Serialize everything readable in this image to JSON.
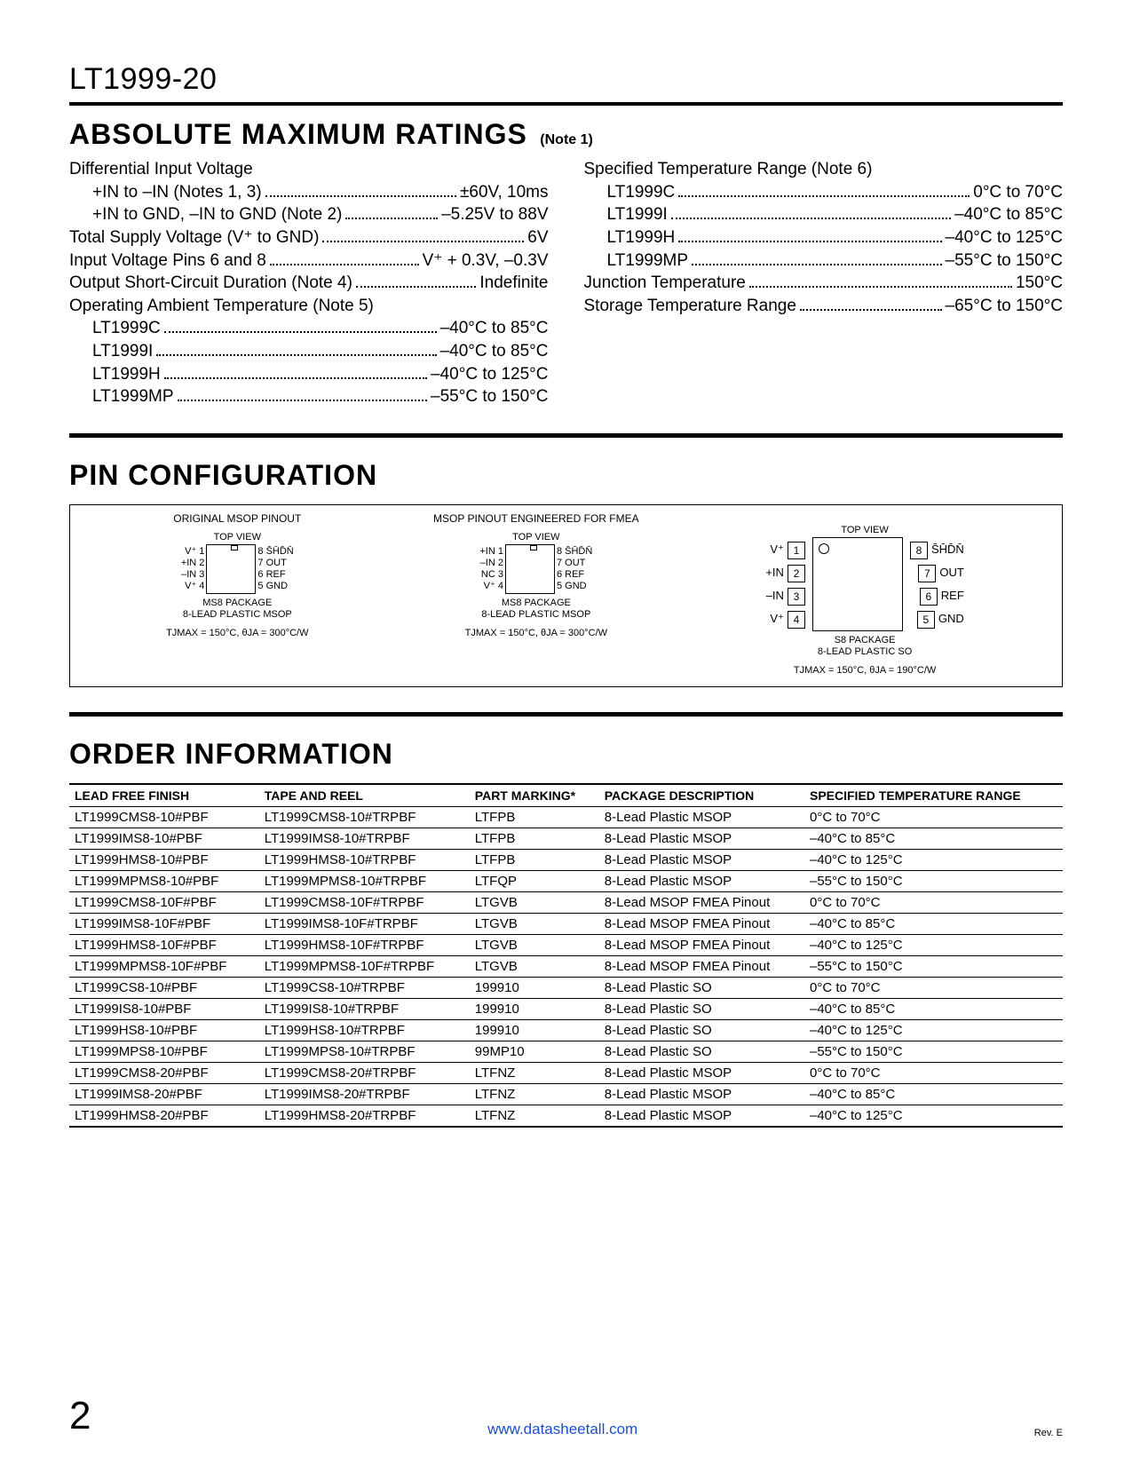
{
  "header": {
    "part": "LT1999-20"
  },
  "sections": {
    "abs": {
      "title": "ABSOLUTE MAXIMUM RATINGS",
      "note": "(Note 1)"
    },
    "pin": {
      "title": "PIN CONFIGURATION"
    },
    "order": {
      "title": "ORDER INFORMATION"
    }
  },
  "abs_left": {
    "h0": "Differential Input Voltage",
    "l1a": "+IN to –IN (Notes 1, 3)",
    "l1b": "±60V, 10ms",
    "l2a": "+IN to GND, –IN to GND (Note 2)",
    "l2b": "–5.25V to 88V",
    "l3a": "Total Supply Voltage (V⁺ to GND)",
    "l3b": "6V",
    "l4a": "Input Voltage Pins 6 and 8",
    "l4b": "V⁺ + 0.3V, –0.3V",
    "l5a": "Output Short-Circuit Duration (Note 4)",
    "l5b": "Indefinite",
    "l6a": "Operating Ambient Temperature (Note 5)",
    "i1a": "LT1999C",
    "i1b": "–40°C to 85°C",
    "i2a": "LT1999I",
    "i2b": "–40°C to 85°C",
    "i3a": "LT1999H",
    "i3b": "–40°C to 125°C",
    "i4a": "LT1999MP",
    "i4b": "–55°C to 150°C"
  },
  "abs_right": {
    "h0": "Specified Temperature Range (Note 6)",
    "i1a": "LT1999C",
    "i1b": "0°C to 70°C",
    "i2a": "LT1999I",
    "i2b": "–40°C to 85°C",
    "i3a": "LT1999H",
    "i3b": "–40°C to 125°C",
    "i4a": "LT1999MP",
    "i4b": "–55°C to 150°C",
    "l1a": "Junction Temperature",
    "l1b": "150°C",
    "l2a": "Storage Temperature Range",
    "l2b": "–65°C to 150°C"
  },
  "pkg": {
    "a": {
      "title": "ORIGINAL MSOP PINOUT",
      "top": "TOP VIEW",
      "left": [
        "V⁺ 1",
        "+IN 2",
        "–IN 3",
        "V⁺ 4"
      ],
      "right": [
        "8  S̄H̄D̄N̄",
        "7  OUT",
        "6  REF",
        "5  GND"
      ],
      "pkg1": "MS8 PACKAGE",
      "pkg2": "8-LEAD PLASTIC MSOP",
      "thermal": "TJMAX = 150°C, θJA = 300°C/W"
    },
    "b": {
      "title": "MSOP PINOUT ENGINEERED FOR FMEA",
      "top": "TOP VIEW",
      "left": [
        "+IN 1",
        "–IN 2",
        "NC 3",
        "V⁺ 4"
      ],
      "right": [
        "8  S̄H̄D̄N̄",
        "7  OUT",
        "6  REF",
        "5  GND"
      ],
      "pkg1": "MS8 PACKAGE",
      "pkg2": "8-LEAD PLASTIC MSOP",
      "thermal": "TJMAX = 150°C, θJA = 300°C/W"
    },
    "c": {
      "top": "TOP VIEW",
      "left": [
        "V⁺",
        "+IN",
        "–IN",
        "V⁺"
      ],
      "leftnum": [
        "1",
        "2",
        "3",
        "4"
      ],
      "rightnum": [
        "8",
        "7",
        "6",
        "5"
      ],
      "right": [
        "S̄H̄D̄N̄",
        "OUT",
        "REF",
        "GND"
      ],
      "pkg1": "S8 PACKAGE",
      "pkg2": "8-LEAD PLASTIC SO",
      "thermal": "TJMAX = 150°C, θJA = 190°C/W"
    }
  },
  "order": {
    "headers": [
      "LEAD FREE FINISH",
      "TAPE AND REEL",
      "PART MARKING*",
      "PACKAGE DESCRIPTION",
      "SPECIFIED TEMPERATURE RANGE"
    ],
    "rows": [
      [
        "LT1999CMS8-10#PBF",
        "LT1999CMS8-10#TRPBF",
        "LTFPB",
        "8-Lead Plastic MSOP",
        "0°C to 70°C"
      ],
      [
        "LT1999IMS8-10#PBF",
        "LT1999IMS8-10#TRPBF",
        "LTFPB",
        "8-Lead Plastic MSOP",
        "–40°C to 85°C"
      ],
      [
        "LT1999HMS8-10#PBF",
        "LT1999HMS8-10#TRPBF",
        "LTFPB",
        "8-Lead Plastic MSOP",
        "–40°C to 125°C"
      ],
      [
        "LT1999MPMS8-10#PBF",
        "LT1999MPMS8-10#TRPBF",
        "LTFQP",
        "8-Lead Plastic MSOP",
        "–55°C to 150°C"
      ],
      [
        "LT1999CMS8-10F#PBF",
        "LT1999CMS8-10F#TRPBF",
        "LTGVB",
        "8-Lead MSOP FMEA Pinout",
        "0°C to 70°C"
      ],
      [
        "LT1999IMS8-10F#PBF",
        "LT1999IMS8-10F#TRPBF",
        "LTGVB",
        "8-Lead MSOP FMEA Pinout",
        "–40°C to 85°C"
      ],
      [
        "LT1999HMS8-10F#PBF",
        "LT1999HMS8-10F#TRPBF",
        "LTGVB",
        "8-Lead MSOP FMEA Pinout",
        "–40°C to 125°C"
      ],
      [
        "LT1999MPMS8-10F#PBF",
        "LT1999MPMS8-10F#TRPBF",
        "LTGVB",
        "8-Lead MSOP FMEA Pinout",
        "–55°C to 150°C"
      ],
      [
        "LT1999CS8-10#PBF",
        "LT1999CS8-10#TRPBF",
        "199910",
        "8-Lead Plastic SO",
        "0°C to 70°C"
      ],
      [
        "LT1999IS8-10#PBF",
        "LT1999IS8-10#TRPBF",
        "199910",
        "8-Lead Plastic SO",
        "–40°C to 85°C"
      ],
      [
        "LT1999HS8-10#PBF",
        "LT1999HS8-10#TRPBF",
        "199910",
        "8-Lead Plastic SO",
        "–40°C to 125°C"
      ],
      [
        "LT1999MPS8-10#PBF",
        "LT1999MPS8-10#TRPBF",
        "99MP10",
        "8-Lead Plastic SO",
        "–55°C to 150°C"
      ],
      [
        "LT1999CMS8-20#PBF",
        "LT1999CMS8-20#TRPBF",
        "LTFNZ",
        "8-Lead Plastic MSOP",
        "0°C to 70°C"
      ],
      [
        "LT1999IMS8-20#PBF",
        "LT1999IMS8-20#TRPBF",
        "LTFNZ",
        "8-Lead Plastic MSOP",
        "–40°C to 85°C"
      ],
      [
        "LT1999HMS8-20#PBF",
        "LT1999HMS8-20#TRPBF",
        "LTFNZ",
        "8-Lead Plastic MSOP",
        "–40°C to 125°C"
      ]
    ]
  },
  "footer": {
    "page": "2",
    "link": "www.datasheetall.com",
    "rev": "Rev. E"
  }
}
